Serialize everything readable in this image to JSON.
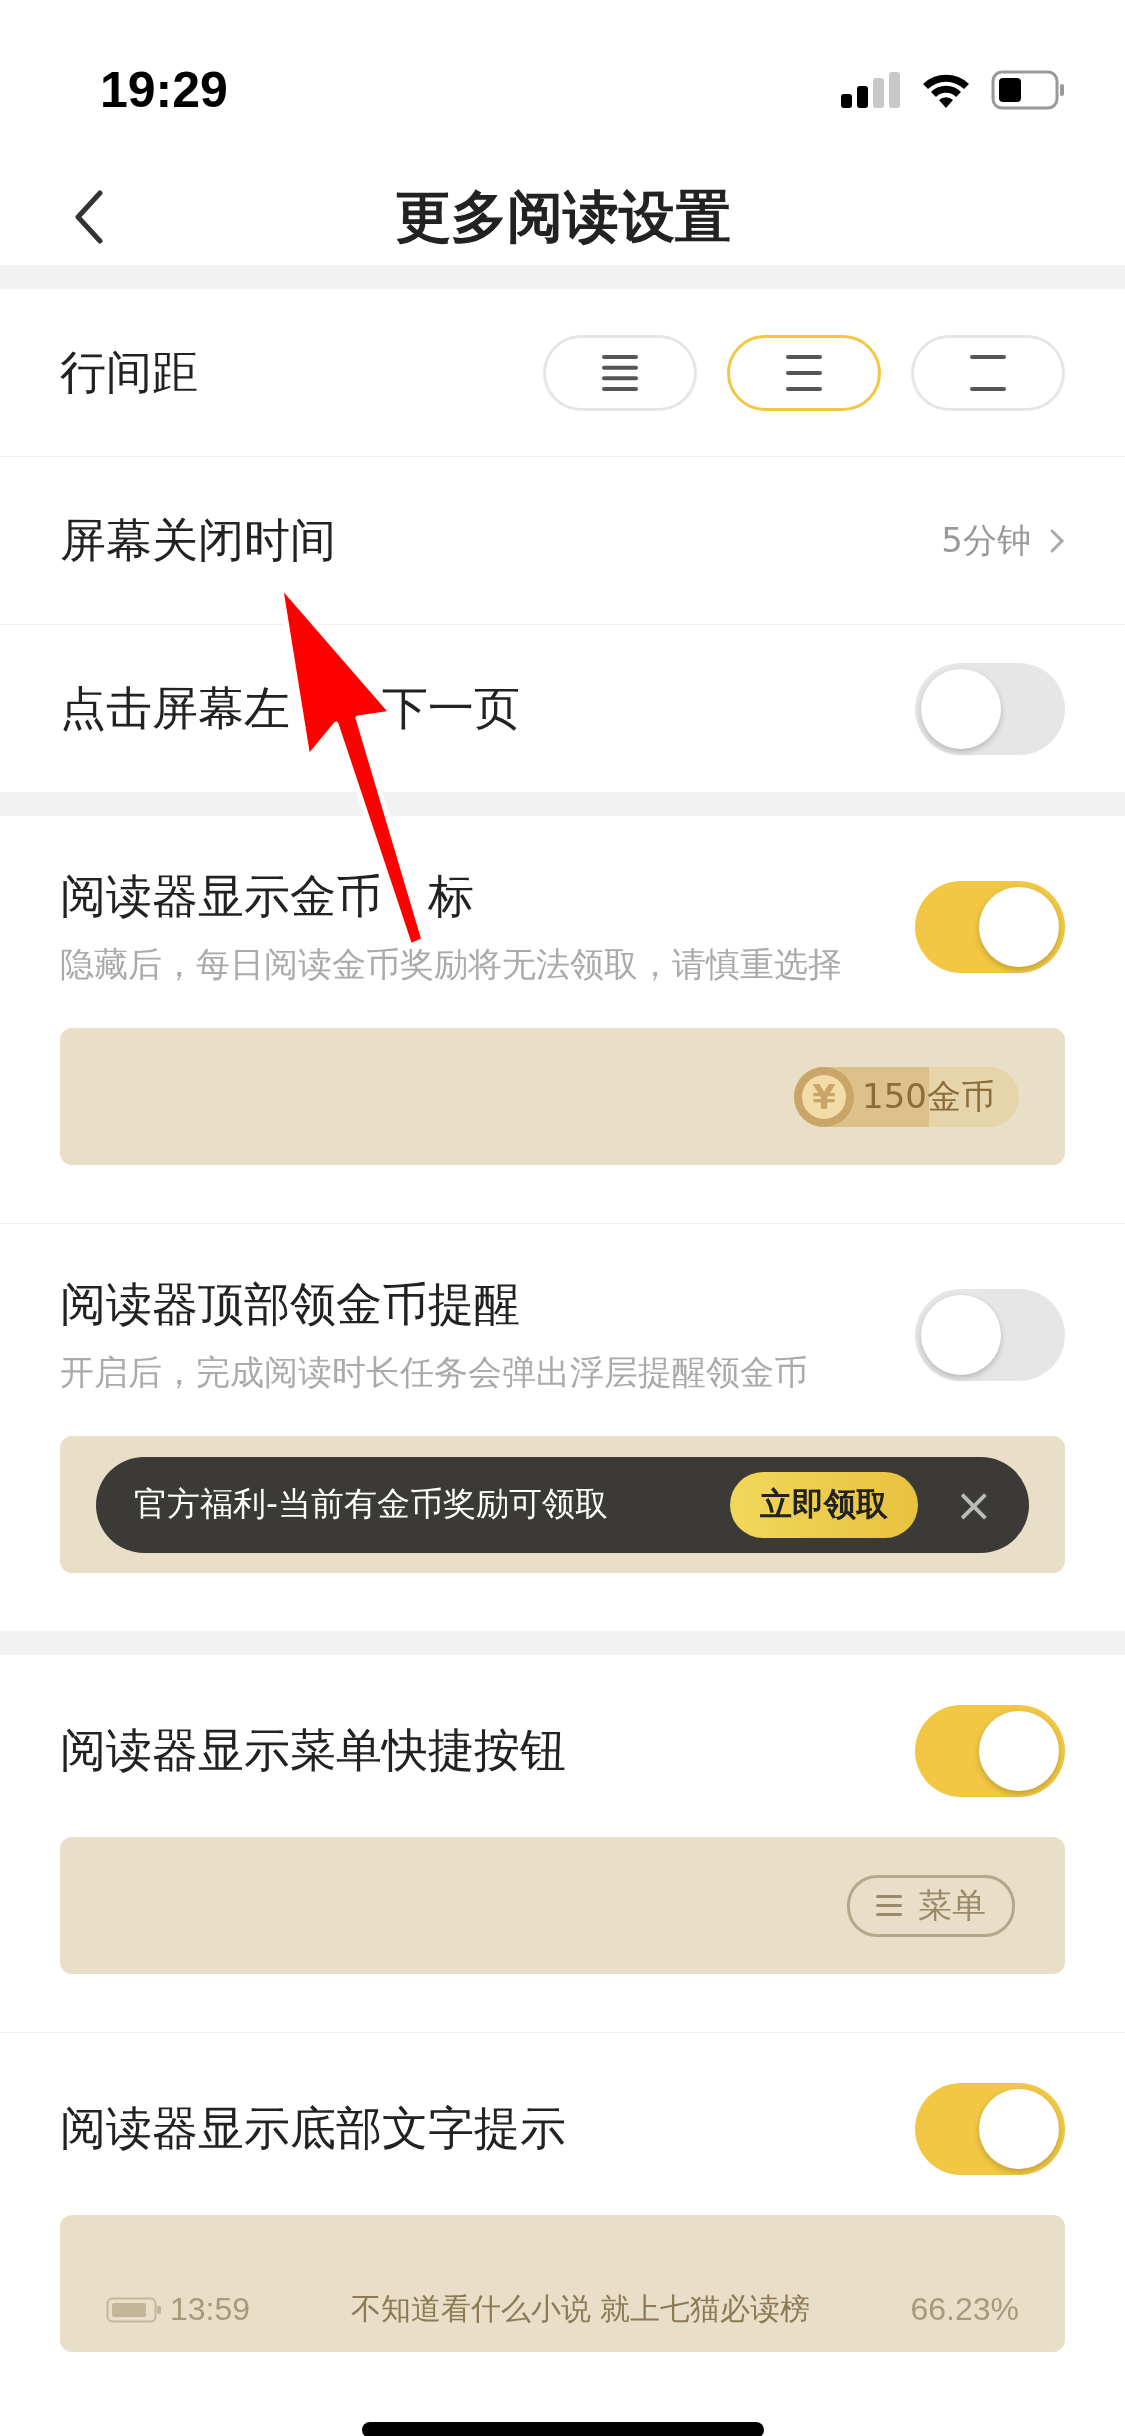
{
  "status_bar": {
    "time": "19:29"
  },
  "nav": {
    "title": "更多阅读设置"
  },
  "line_spacing": {
    "label": "行间距",
    "options": [
      {
        "kind": "compact",
        "selected": false
      },
      {
        "kind": "standard",
        "selected": true
      },
      {
        "kind": "loose",
        "selected": false
      }
    ]
  },
  "screen_off": {
    "label": "屏幕关闭时间",
    "value": "5分钟"
  },
  "tap_left": {
    "label_parts": [
      "点击屏幕左",
      "下一页"
    ],
    "on": false
  },
  "sections": [
    {
      "kind": "coin",
      "title_parts": [
        "阅读器显示金币",
        "标"
      ],
      "subtitle": "隐藏后，每日阅读金币奖励将无法领取，请慎重选择",
      "on": true,
      "preview": {
        "coin_symbol": "¥",
        "amount": "150金币"
      }
    },
    {
      "kind": "banner",
      "title": "阅读器顶部领金币提醒",
      "subtitle": "开启后，完成阅读时长任务会弹出浮层提醒领金币",
      "on": false,
      "preview": {
        "text": "官方福利-当前有金币奖励可领取",
        "button": "立即领取",
        "close": "×"
      }
    },
    {
      "kind": "menu",
      "title": "阅读器显示菜单快捷按钮",
      "on": true,
      "preview": {
        "label": "菜单"
      }
    },
    {
      "kind": "footer",
      "title": "阅读器显示底部文字提示",
      "on": true,
      "preview": {
        "time": "13:59",
        "text": "不知道看什么小说 就上七猫必读榜",
        "progress": "66.23%"
      }
    }
  ]
}
